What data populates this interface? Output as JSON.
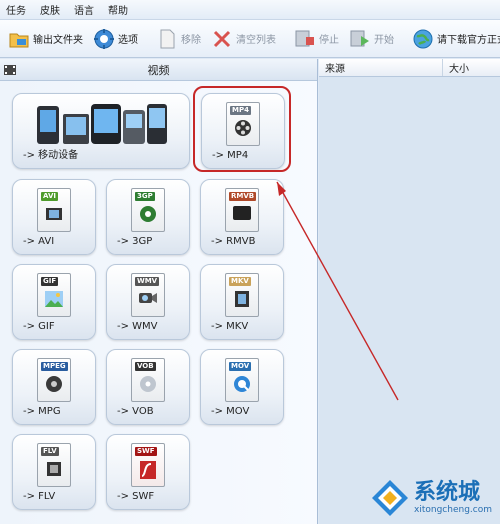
{
  "menu": {
    "items": [
      "任务",
      "皮肤",
      "语言",
      "帮助"
    ]
  },
  "toolbar": {
    "output_folder": "输出文件夹",
    "options": "选项",
    "remove": "移除",
    "clear_list": "清空列表",
    "stop": "停止",
    "start": "开始",
    "download": "请下载官方正式"
  },
  "left_panel": {
    "title": "视频",
    "tiles": [
      {
        "label": "-> 移动设备",
        "format": ""
      },
      {
        "label": "-> MP4",
        "format": "MP4"
      },
      {
        "label": "-> AVI",
        "format": "AVI"
      },
      {
        "label": "-> 3GP",
        "format": "3GP"
      },
      {
        "label": "-> RMVB",
        "format": "RMVB"
      },
      {
        "label": "-> GIF",
        "format": "GIF"
      },
      {
        "label": "-> WMV",
        "format": "WMV"
      },
      {
        "label": "-> MKV",
        "format": "MKV"
      },
      {
        "label": "-> MPG",
        "format": "MPEG"
      },
      {
        "label": "-> VOB",
        "format": "VOB"
      },
      {
        "label": "-> MOV",
        "format": "MOV"
      },
      {
        "label": "-> FLV",
        "format": "FLV"
      },
      {
        "label": "-> SWF",
        "format": "SWF"
      }
    ]
  },
  "right_panel": {
    "columns": [
      "来源",
      "大小"
    ]
  },
  "watermark": {
    "main": "系统城",
    "sub": "xitongcheng.com"
  },
  "colors": {
    "highlight": "#c62828",
    "accent": "#1b6fb7"
  }
}
